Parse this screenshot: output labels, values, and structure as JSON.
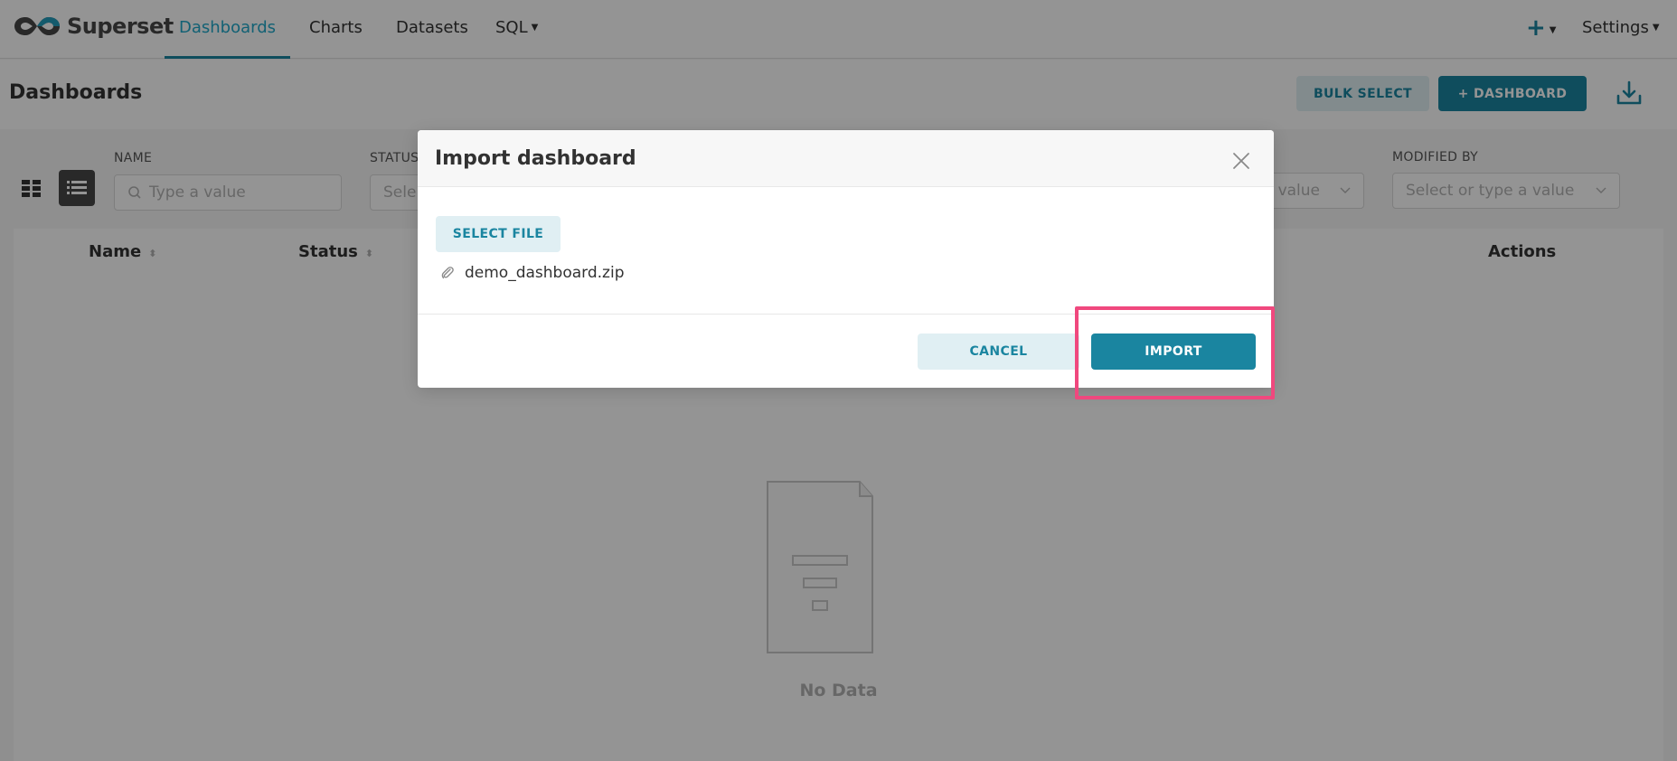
{
  "brand": {
    "name": "Superset"
  },
  "nav": {
    "items": [
      {
        "label": "Dashboards",
        "active": true
      },
      {
        "label": "Charts"
      },
      {
        "label": "Datasets"
      },
      {
        "label": "SQL",
        "has_dropdown": true
      }
    ],
    "right": {
      "plus_label": "+",
      "settings_label": "Settings"
    }
  },
  "page": {
    "title": "Dashboards",
    "bulk_select_label": "BULK SELECT",
    "add_dashboard_label": "+ DASHBOARD"
  },
  "filters": {
    "name_label": "NAME",
    "name_placeholder": "Type a value",
    "status_label": "STATUS",
    "status_placeholder": "Sele",
    "owner_placeholder": "value",
    "modified_by_label": "MODIFIED BY",
    "modified_by_placeholder": "Select or type a value"
  },
  "table": {
    "columns": [
      "Name",
      "Status",
      "Actions"
    ],
    "empty_text": "No Data"
  },
  "modal": {
    "title": "Import dashboard",
    "select_file_label": "SELECT FILE",
    "file_name": "demo_dashboard.zip",
    "cancel_label": "CANCEL",
    "import_label": "IMPORT"
  },
  "colors": {
    "primary": "#1a85a0",
    "primary_light": "#e0eff3",
    "active_nav": "#20a7c9",
    "highlight": "#f0487e"
  }
}
